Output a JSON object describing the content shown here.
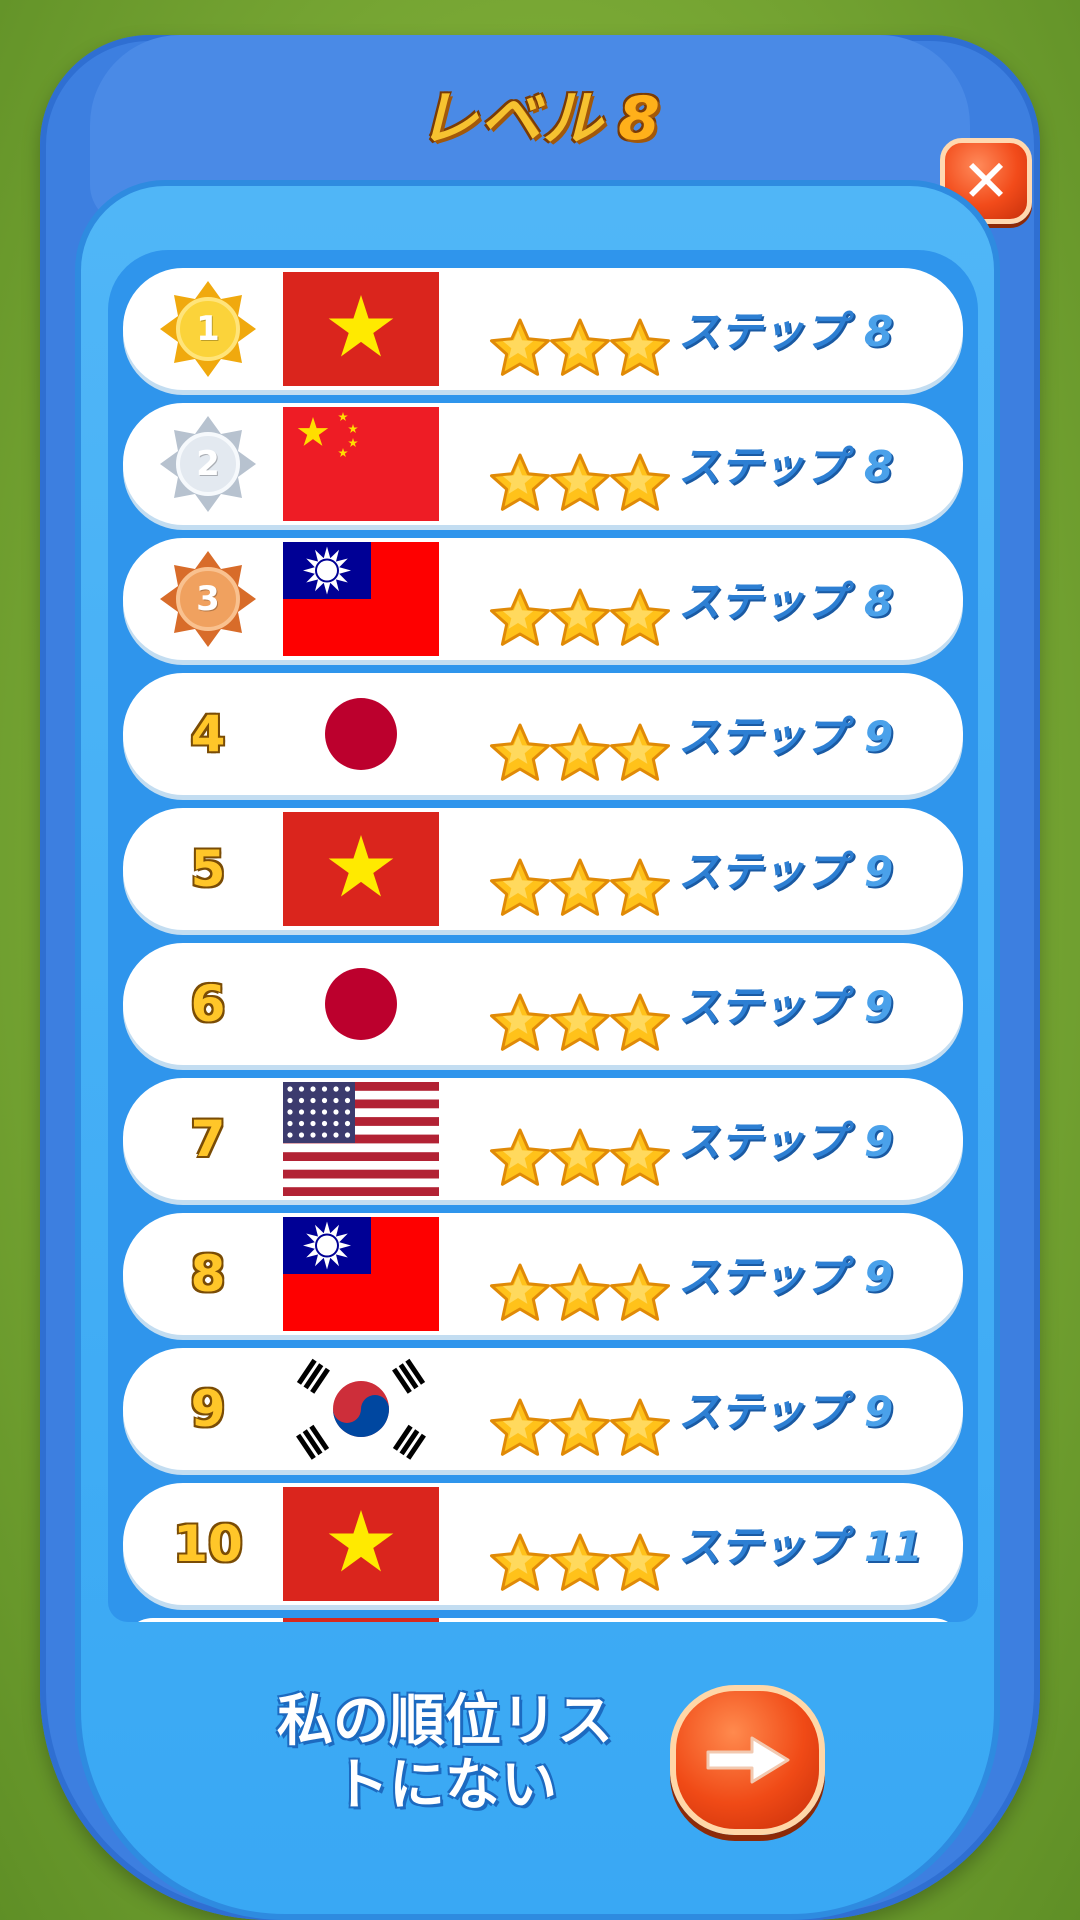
{
  "header": {
    "title": "レベル",
    "level": "8",
    "close_label": "✕"
  },
  "rows": [
    {
      "rank": "1",
      "medal": "gold",
      "flag": "vietnam",
      "stars": 3,
      "steps_label": "ステップ",
      "steps": "8"
    },
    {
      "rank": "2",
      "medal": "silver",
      "flag": "china",
      "stars": 3,
      "steps_label": "ステップ",
      "steps": "8"
    },
    {
      "rank": "3",
      "medal": "bronze",
      "flag": "taiwan",
      "stars": 3,
      "steps_label": "ステップ",
      "steps": "8"
    },
    {
      "rank": "4",
      "medal": null,
      "flag": "japan",
      "stars": 3,
      "steps_label": "ステップ",
      "steps": "9"
    },
    {
      "rank": "5",
      "medal": null,
      "flag": "vietnam",
      "stars": 3,
      "steps_label": "ステップ",
      "steps": "9"
    },
    {
      "rank": "6",
      "medal": null,
      "flag": "japan",
      "stars": 3,
      "steps_label": "ステップ",
      "steps": "9"
    },
    {
      "rank": "7",
      "medal": null,
      "flag": "usa",
      "stars": 3,
      "steps_label": "ステップ",
      "steps": "9"
    },
    {
      "rank": "8",
      "medal": null,
      "flag": "taiwan",
      "stars": 3,
      "steps_label": "ステップ",
      "steps": "9"
    },
    {
      "rank": "9",
      "medal": null,
      "flag": "south-korea",
      "stars": 3,
      "steps_label": "ステップ",
      "steps": "9"
    },
    {
      "rank": "10",
      "medal": null,
      "flag": "vietnam",
      "stars": 3,
      "steps_label": "ステップ",
      "steps": "11"
    }
  ],
  "footer": {
    "my_rank_text": "私の順位リストにない",
    "next_icon": "arrow-right-icon"
  },
  "colors": {
    "frame": "#3d7fe0",
    "panel": "#39a8f4",
    "title": "#f6c230",
    "button": "#f04a16",
    "steps": "#2d7fd3"
  }
}
